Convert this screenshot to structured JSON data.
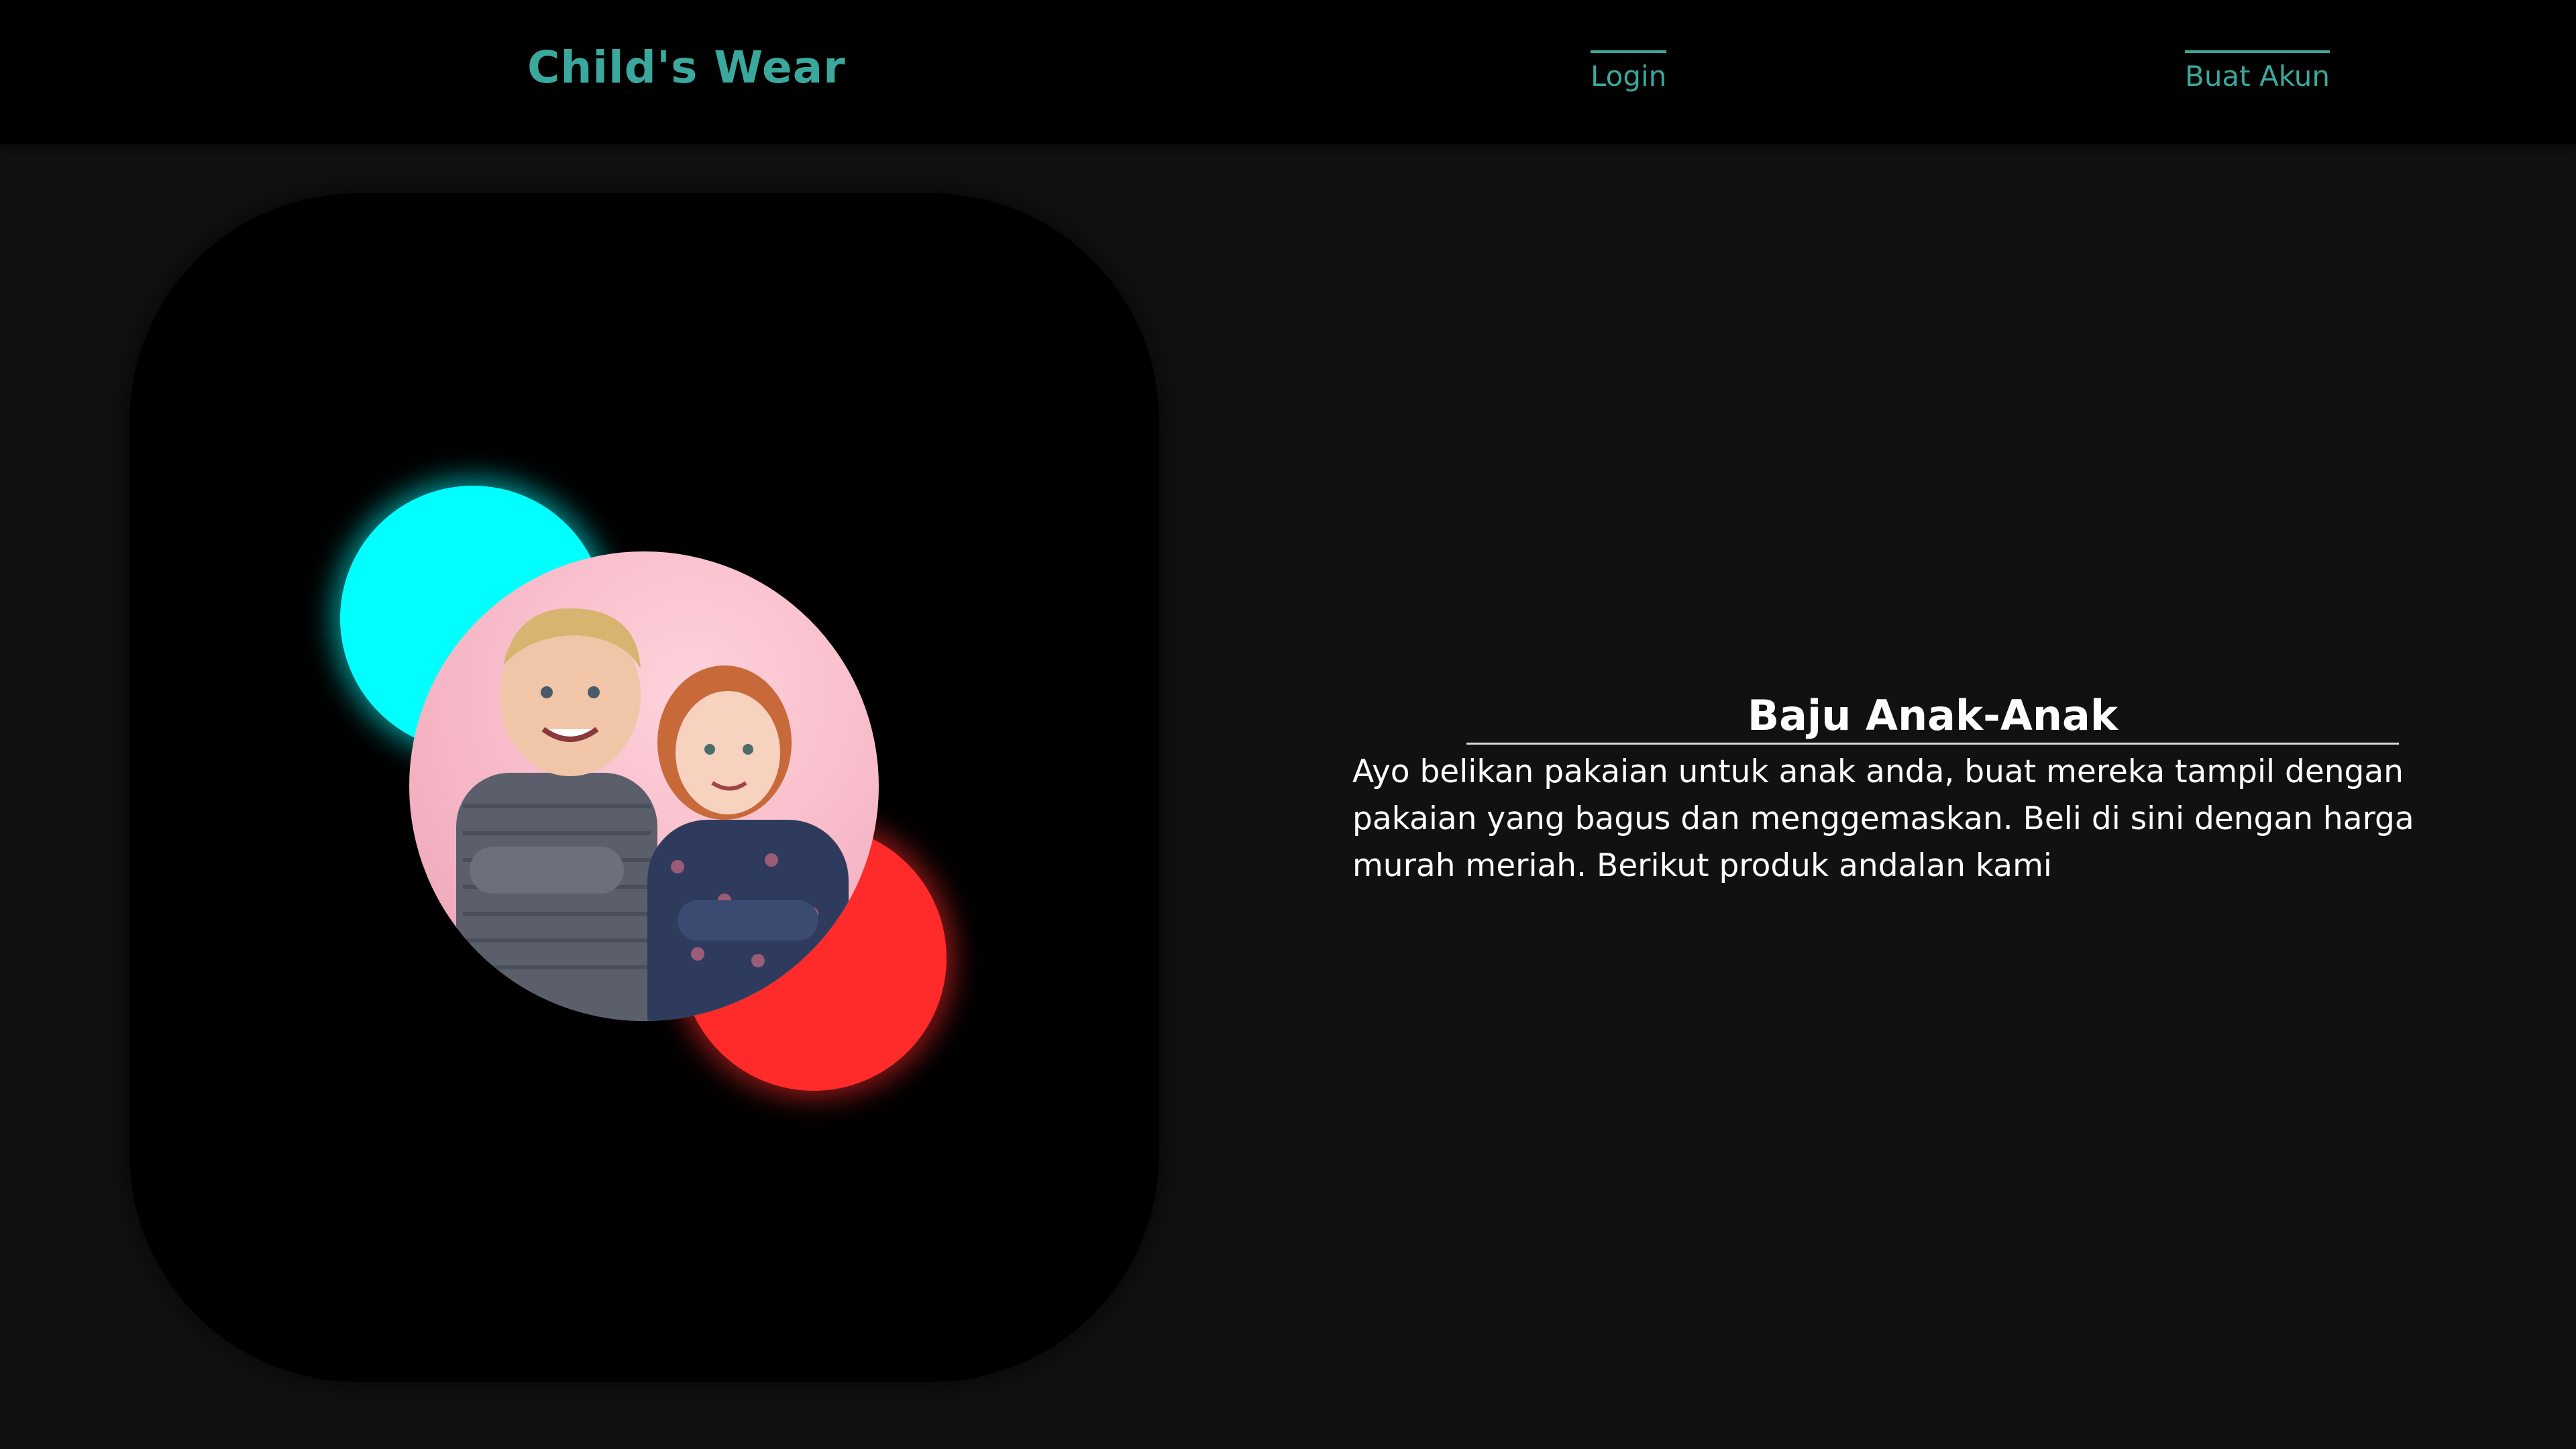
{
  "header": {
    "brand": "Child's Wear",
    "nav": {
      "login": "Login",
      "signup": "Buat Akun"
    }
  },
  "hero": {
    "image_alt": "Two children standing back to back",
    "title": "Baju Anak-Anak",
    "description": "Ayo belikan pakaian untuk anak anda, buat mereka tampil dengan pakaian yang bagus dan menggemaskan. Beli di sini dengan harga murah meriah. Berikut produk andalan kami"
  },
  "colors": {
    "accent": "#3aa89c",
    "glow_cyan": "#00ffff",
    "glow_red": "#ff2b2b",
    "background": "#111111",
    "navbar": "#000000"
  }
}
